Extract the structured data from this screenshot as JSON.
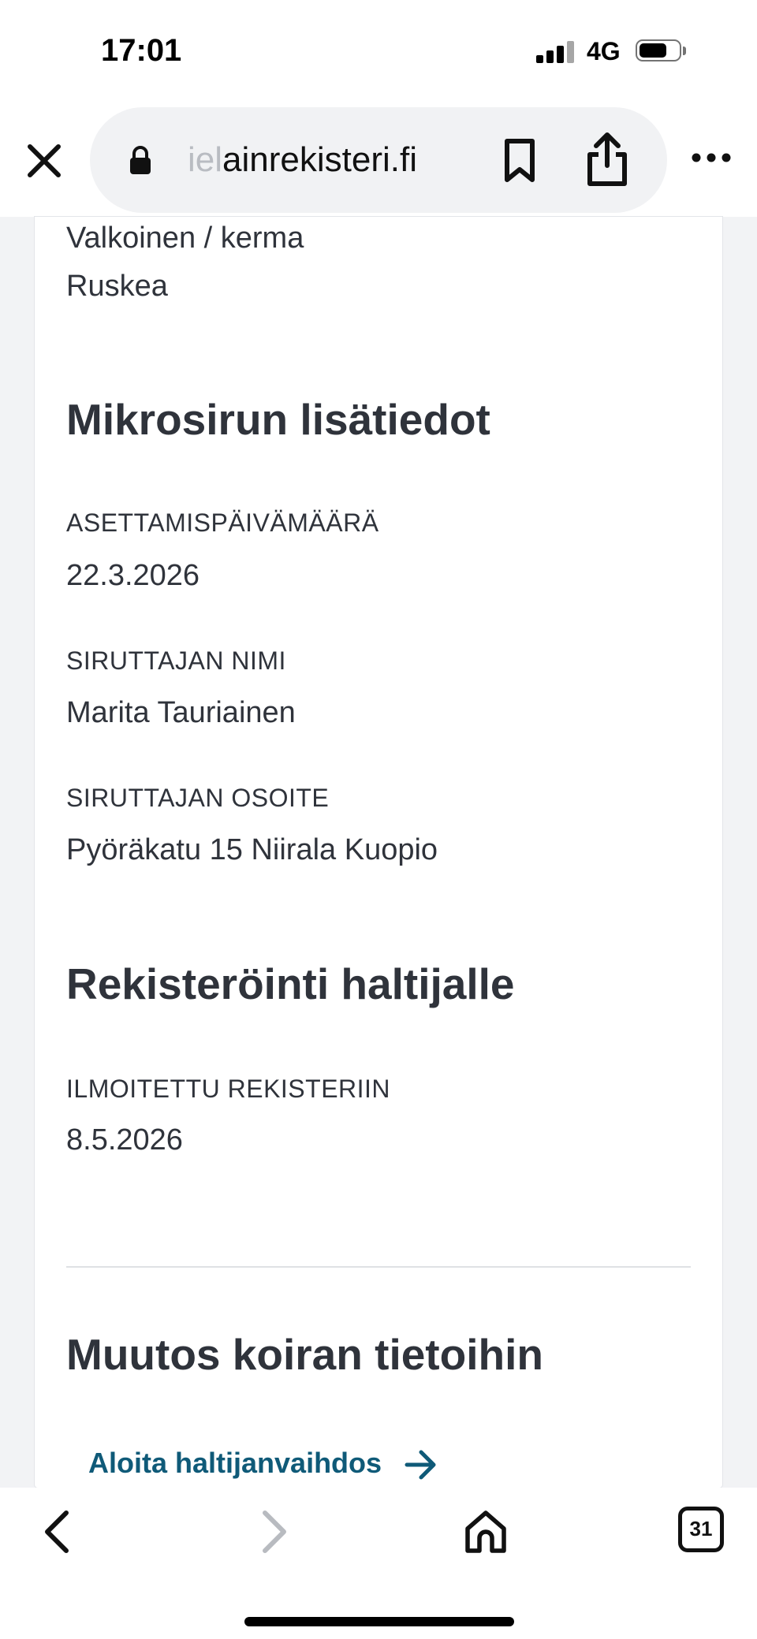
{
  "status_bar": {
    "time": "17:01",
    "network": "4G"
  },
  "browser": {
    "url_faded": "iel",
    "url_main": "ainrekisteri.fi",
    "icons": [
      "close-icon",
      "lock-icon",
      "bookmark-icon",
      "share-icon",
      "more-icon"
    ]
  },
  "content": {
    "colors": [
      "Valkoinen / kerma",
      "Ruskea"
    ],
    "microchip": {
      "heading": "Mikrosirun lisätiedot",
      "fields": [
        {
          "label": "ASETTAMISPÄIVÄMÄÄRÄ",
          "value": "22.3.2026"
        },
        {
          "label": "SIRUTTAJAN NIMI",
          "value": "Marita Tauriainen"
        },
        {
          "label": "SIRUTTAJAN OSOITE",
          "value": "Pyöräkatu 15 Niirala Kuopio"
        }
      ]
    },
    "registration": {
      "heading": "Rekisteröinti haltijalle",
      "fields": [
        {
          "label": "ILMOITETTU REKISTERIIN",
          "value": "8.5.2026"
        }
      ]
    },
    "change": {
      "heading": "Muutos koiran tietoihin",
      "link": "Aloita haltijanvaihdos"
    },
    "accent_color": "#0f5a78"
  },
  "toolbar": {
    "tab_count": "31",
    "icons": [
      "back-icon",
      "forward-icon",
      "home-icon",
      "tabs-icon"
    ]
  }
}
